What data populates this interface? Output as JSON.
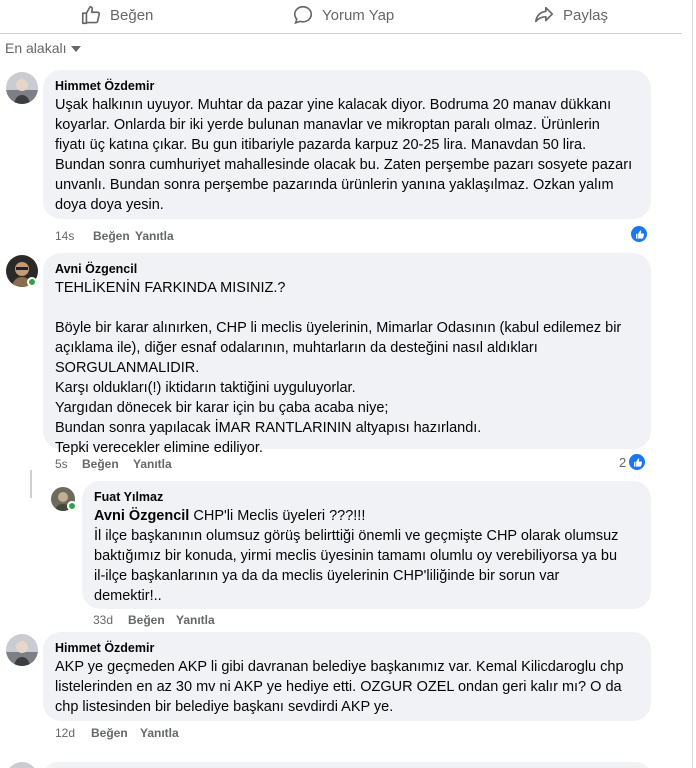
{
  "actions": {
    "like_label": "Beğen",
    "comment_label": "Yorum Yap",
    "share_label": "Paylaş"
  },
  "sort": {
    "label": "En alakalı"
  },
  "comments": [
    {
      "author": "Himmet Özdemir",
      "text": "Uşak halkının uyuyor. Muhtar da pazar yine kalacak diyor. Bodruma 20 manav dükkanı\nkoyarlar. Onlarda bir iki yerde bulunan manavlar ve mikroptan paralı olmaz. Ürünlerin\nfiyatı üç katına çıkar. Bu gun itibariyle pazarda karpuz 20-25 lira. Manavdan 50 lira.\nBundan sonra cumhuriyet mahallesinde olacak bu. Zaten perşembe pazarı sosyete pazarı\nunvanlı. Bundan sonra perşembe pazarında ürünlerin yanına yaklaşılmaz. Ozkan yalım\ndoya doya yesin.",
      "time": "14s",
      "like": "Beğen",
      "reply": "Yanıtla"
    },
    {
      "author": "Avni Özgencil",
      "text": "TEHLİKENİN FARKINDA MISINIZ.?\n\nBöyle bir karar alınırken, CHP li meclis üyelerinin, Mimarlar Odasının (kabul edilemez bir\naçıklama ile), diğer esnaf odalarının, muhtarların da desteğini nasıl aldıkları\nSORGULANMALIDIR.\nKarşı oldukları(!) iktidarın taktiğini uyguluyorlar.\nYargıdan dönecek bir karar için bu çaba acaba niye;\nBundan sonra yapılacak İMAR RANTLARININ altyapısı hazırlandı.\nTepki verecekler elimine ediliyor.",
      "time": "5s",
      "like": "Beğen",
      "reply": "Yanıtla",
      "reactions": "2"
    },
    {
      "author": "Fuat Yılmaz",
      "mention": "Avni Özgencil",
      "text_first": " CHP'li Meclis üyeleri ???!!!",
      "text": "İl ilçe başkanının olumsuz görüş belirttiği önemli ve geçmişte CHP olarak olumsuz\nbaktığımız bir konuda, yirmi meclis üyesinin tamamı olumlu oy verebiliyorsa ya bu\nil-ilçe başkanlarının ya da da meclis üyelerinin CHP'liliğinde bir sorun var\ndemektir!..",
      "time": "33d",
      "like": "Beğen",
      "reply": "Yanıtla"
    },
    {
      "author": "Himmet Özdemir",
      "text": "AKP ye geçmeden AKP li gibi davranan belediye başkanımız var. Kemal Kilicdaroglu chp\nlistelerinden en az 30 mv ni AKP ye hediye etti. OZGUR OZEL ondan geri kalır mı? O da\nchp listesinden bir belediye başkanı sevdirdi AKP ye.",
      "time": "12d",
      "like": "Beğen",
      "reply": "Yanıtla"
    }
  ],
  "colors": {
    "accent": "#1877f2",
    "bubble": "#f0f2f5",
    "muted": "#65676b",
    "online": "#31a24c"
  }
}
